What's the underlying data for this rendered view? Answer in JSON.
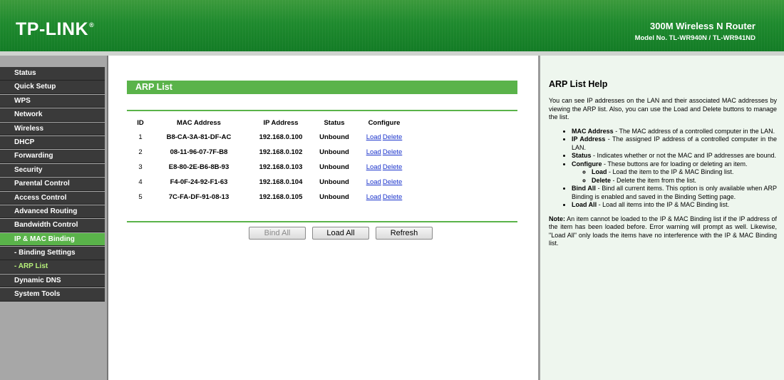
{
  "header": {
    "logo": "TP-LINK",
    "logo_mark": "®",
    "product": "300M Wireless N Router",
    "model": "Model No. TL-WR940N / TL-WR941ND"
  },
  "sidebar": {
    "items": [
      {
        "label": "Status"
      },
      {
        "label": "Quick Setup"
      },
      {
        "label": "WPS"
      },
      {
        "label": "Network"
      },
      {
        "label": "Wireless"
      },
      {
        "label": "DHCP"
      },
      {
        "label": "Forwarding"
      },
      {
        "label": "Security"
      },
      {
        "label": "Parental Control"
      },
      {
        "label": "Access Control"
      },
      {
        "label": "Advanced Routing"
      },
      {
        "label": "Bandwidth Control"
      },
      {
        "label": "IP & MAC Binding"
      },
      {
        "label": "- Binding Settings"
      },
      {
        "label": "- ARP List"
      },
      {
        "label": "Dynamic DNS"
      },
      {
        "label": "System Tools"
      }
    ],
    "active": "IP & MAC Binding",
    "active_sub": "- ARP List",
    "active_color": "#5ab34a"
  },
  "main": {
    "title": "ARP List",
    "columns": [
      "ID",
      "MAC Address",
      "IP Address",
      "Status",
      "Configure"
    ],
    "rows": [
      {
        "id": "1",
        "mac": "B8-CA-3A-81-DF-AC",
        "ip": "192.168.0.100",
        "status": "Unbound",
        "load": "Load",
        "delete": "Delete"
      },
      {
        "id": "2",
        "mac": "08-11-96-07-7F-B8",
        "ip": "192.168.0.102",
        "status": "Unbound",
        "load": "Load",
        "delete": "Delete"
      },
      {
        "id": "3",
        "mac": "E8-80-2E-B6-8B-93",
        "ip": "192.168.0.103",
        "status": "Unbound",
        "load": "Load",
        "delete": "Delete"
      },
      {
        "id": "4",
        "mac": "F4-0F-24-92-F1-63",
        "ip": "192.168.0.104",
        "status": "Unbound",
        "load": "Load",
        "delete": "Delete"
      },
      {
        "id": "5",
        "mac": "7C-FA-DF-91-08-13",
        "ip": "192.168.0.105",
        "status": "Unbound",
        "load": "Load",
        "delete": "Delete"
      }
    ],
    "buttons": {
      "bind_all": "Bind All",
      "load_all": "Load All",
      "refresh": "Refresh"
    }
  },
  "help": {
    "title": "ARP List Help",
    "intro": "You can see IP addresses on the LAN and their associated MAC addresses by viewing the ARP list. Also, you can use the Load and Delete buttons to manage the list.",
    "mac_term": "MAC Address",
    "mac_desc": " - The MAC address of a controlled computer in the LAN.",
    "ip_term": "IP Address",
    "ip_desc": " - The assigned IP address of a controlled computer in the LAN.",
    "status_term": "Status",
    "status_desc": " - Indicates whether or not the MAC and IP addresses are bound.",
    "configure_term": "Configure",
    "configure_desc": " - These buttons are for loading or deleting an item.",
    "load_term": "Load",
    "load_desc": " - Load the item to the IP & MAC Binding list.",
    "delete_term": "Delete",
    "delete_desc": " - Delete the item from the list.",
    "bindall_term": "Bind All",
    "bindall_desc": " - Bind all current items. This option is only available when ARP Binding is enabled and saved in the Binding Setting page.",
    "loadall_term": "Load All",
    "loadall_desc": " - Load all items into the IP & MAC Binding list.",
    "note_term": "Note:",
    "note_desc": " An item cannot be loaded to the IP & MAC Binding list if the IP address of the item has been loaded before. Error warning will prompt as well. Likewise, \"Load All\" only loads the items have no interference with the IP & MAC Binding list."
  }
}
